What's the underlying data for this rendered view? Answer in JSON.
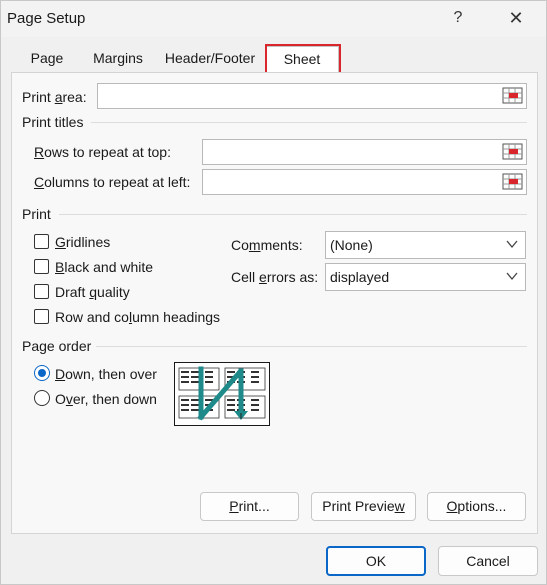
{
  "window": {
    "title": "Page Setup",
    "help": "?",
    "close": "✕"
  },
  "tabs": [
    {
      "label": "Page"
    },
    {
      "label": "Margins"
    },
    {
      "label": "Header/Footer"
    },
    {
      "label": "Sheet",
      "active": true
    }
  ],
  "print_area": {
    "label_u": "a",
    "label_pre": "Print ",
    "label_post": "rea:",
    "value": ""
  },
  "print_titles": {
    "heading": "Print titles",
    "rows": {
      "label_u": "R",
      "label_post": "ows to repeat at top:",
      "value": ""
    },
    "columns": {
      "label_u": "C",
      "label_post": "olumns to repeat at left:",
      "value": ""
    }
  },
  "print": {
    "heading": "Print",
    "gridlines": {
      "label_u": "G",
      "label_post": "ridlines",
      "checked": false
    },
    "black_white": {
      "label_u": "B",
      "label_post": "lack and white",
      "checked": false
    },
    "draft": {
      "label_pre": "Draft ",
      "label_u": "q",
      "label_post": "uality",
      "checked": false
    },
    "headings": {
      "label_pre": "Row and co",
      "label_u": "l",
      "label_post": "umn headings",
      "checked": false
    },
    "comments": {
      "label_pre": "Co",
      "label_u": "m",
      "label_post": "ments:",
      "value": "(None)"
    },
    "cell_errors": {
      "label_pre": "Cell ",
      "label_u": "e",
      "label_post": "rrors as:",
      "value": "displayed"
    }
  },
  "page_order": {
    "heading": "Page order",
    "down_over": {
      "label_u": "D",
      "label_post": "own, then over",
      "selected": true
    },
    "over_down": {
      "label_pre": "O",
      "label_u": "v",
      "label_post": "er, then down",
      "selected": false
    }
  },
  "buttons": {
    "print": {
      "label_u": "P",
      "label_post": "rint..."
    },
    "print_preview": {
      "label_pre": "Print Previe",
      "label_u": "w",
      "label_post": ""
    },
    "options": {
      "label_u": "O",
      "label_post": "ptions..."
    },
    "ok": "OK",
    "cancel": "Cancel"
  },
  "colors": {
    "accent": "#0a67c8",
    "highlight": "#d9262c",
    "arrow": "#1f8a8a"
  },
  "icons": {
    "range_ref": "collapse-range-icon",
    "dropdown": "chevron-down-icon"
  }
}
